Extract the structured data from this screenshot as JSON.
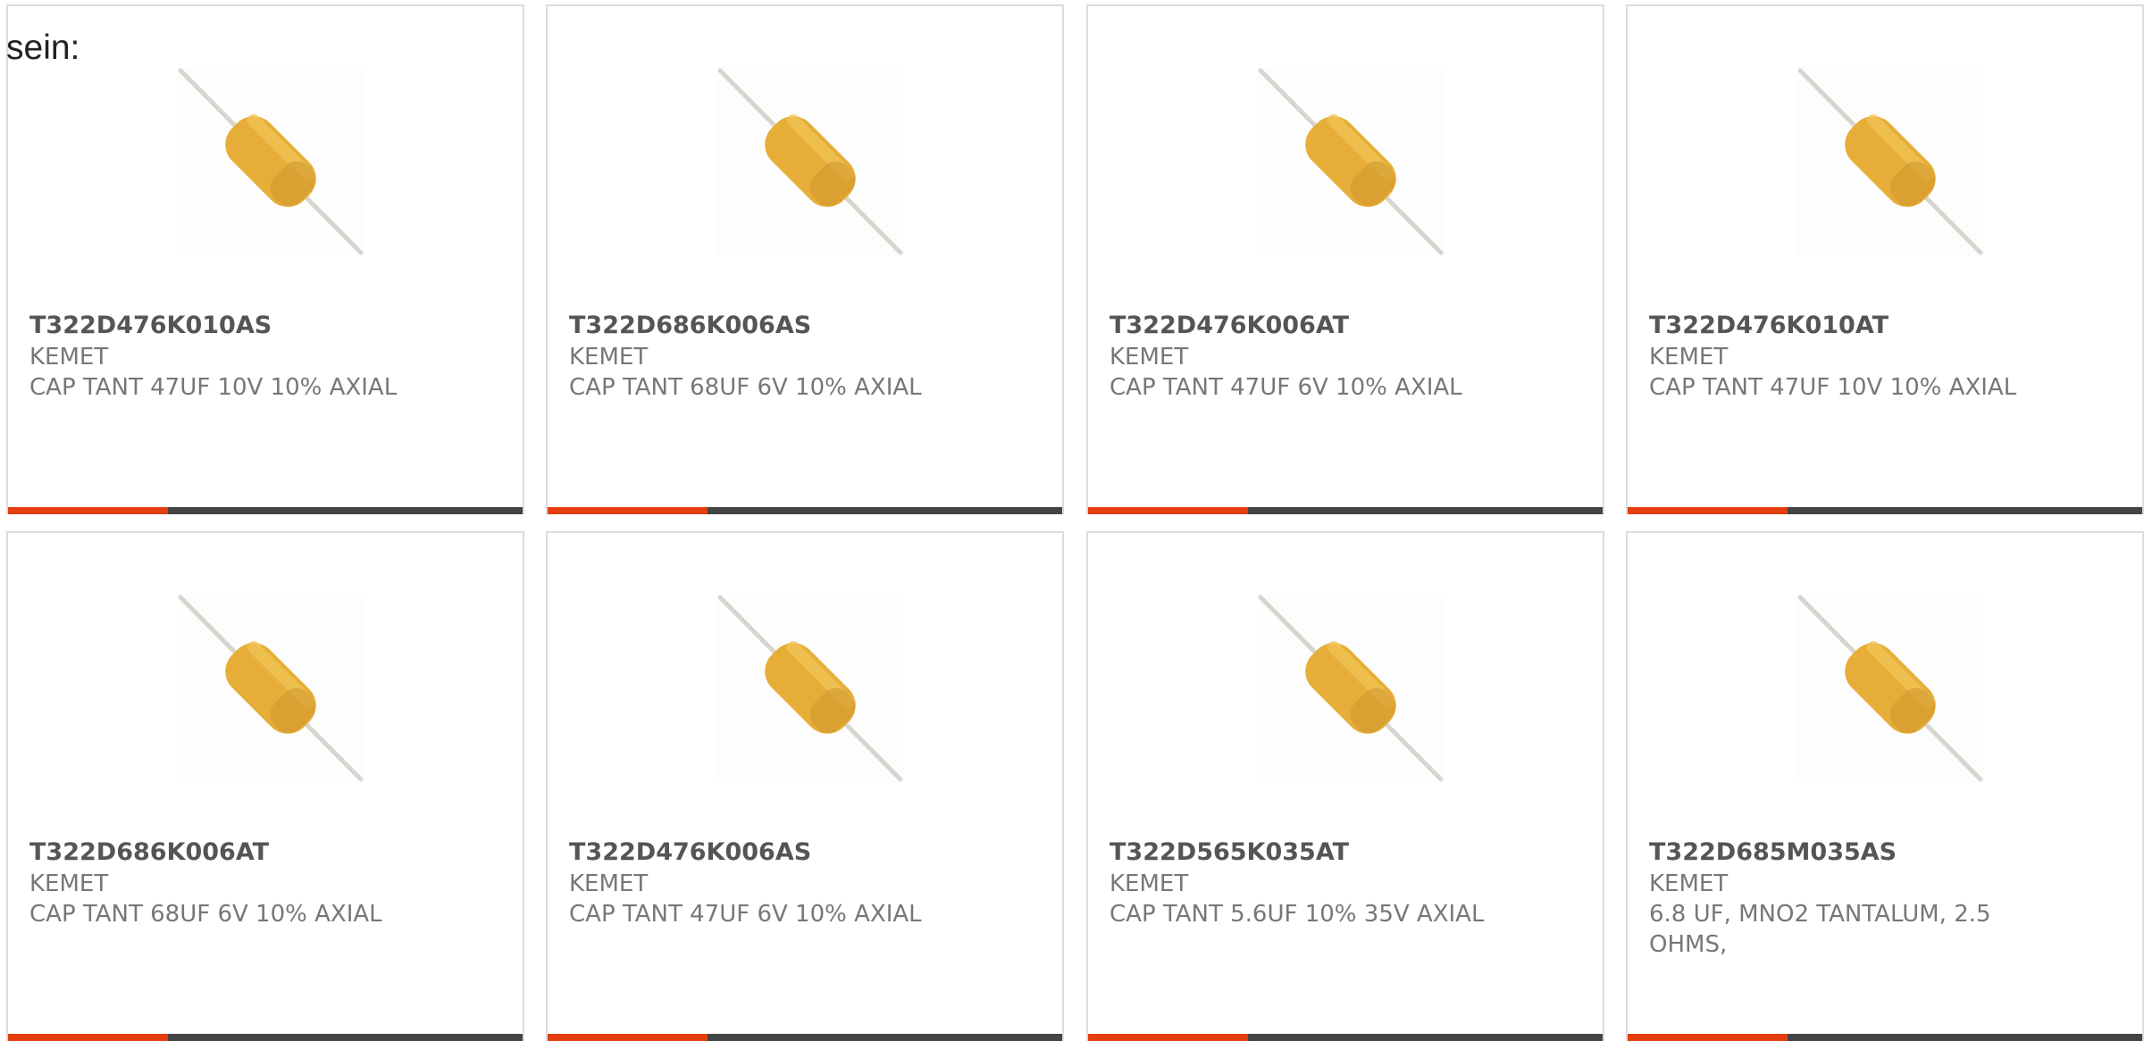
{
  "intro_text": "sein:",
  "colors": {
    "accent": "#e43e0e",
    "bar_track": "#444444",
    "capacitor_body": "#e6ae38",
    "card_border": "#dcdcdc"
  },
  "image_icon": "axial-tantalum-capacitor-icon",
  "bar_fill_fraction": 0.31,
  "products": [
    {
      "part_number": "T322D476K010AS",
      "manufacturer": "KEMET",
      "description": "CAP TANT 47UF 10V 10% AXIAL"
    },
    {
      "part_number": "T322D686K006AS",
      "manufacturer": "KEMET",
      "description": "CAP TANT 68UF 6V 10% AXIAL"
    },
    {
      "part_number": "T322D476K006AT",
      "manufacturer": "KEMET",
      "description": "CAP TANT 47UF 6V 10% AXIAL"
    },
    {
      "part_number": "T322D476K010AT",
      "manufacturer": "KEMET",
      "description": "CAP TANT 47UF 10V 10% AXIAL"
    },
    {
      "part_number": "T322D686K006AT",
      "manufacturer": "KEMET",
      "description": "CAP TANT 68UF 6V 10% AXIAL"
    },
    {
      "part_number": "T322D476K006AS",
      "manufacturer": "KEMET",
      "description": "CAP TANT 47UF 6V 10% AXIAL"
    },
    {
      "part_number": "T322D565K035AT",
      "manufacturer": "KEMET",
      "description": "CAP TANT 5.6UF 10% 35V AXIAL"
    },
    {
      "part_number": "T322D685M035AS",
      "manufacturer": "KEMET",
      "description": "6.8 UF, MNO2 TANTALUM, 2.5 OHMS,"
    }
  ]
}
